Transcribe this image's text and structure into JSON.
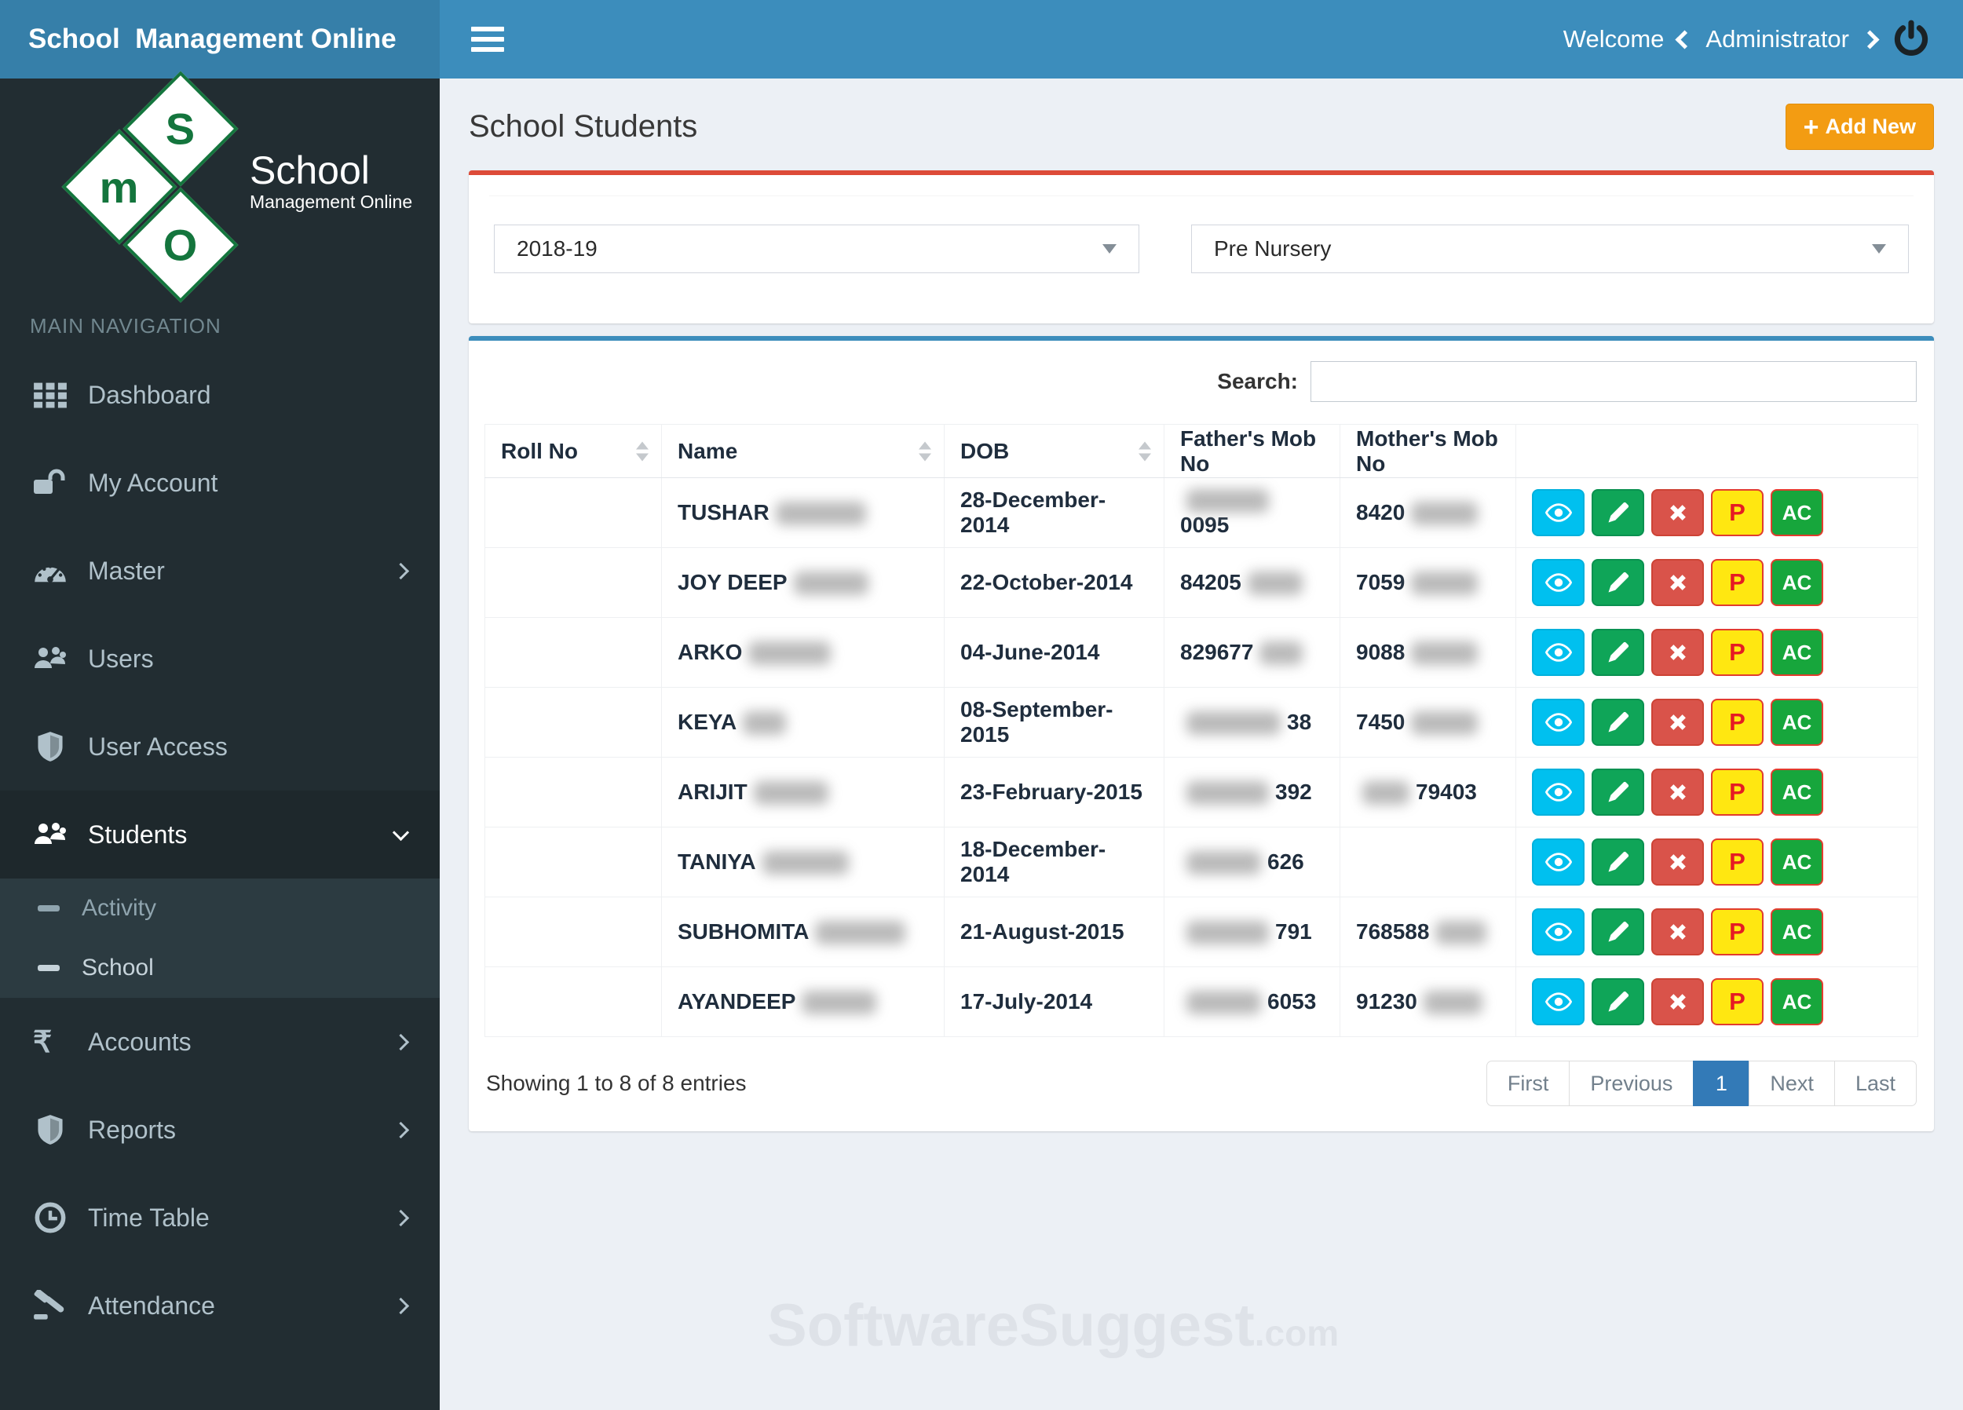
{
  "navbar": {
    "brand": "School  Management Online",
    "welcome": "Welcome",
    "user": "Administrator"
  },
  "logo": {
    "letters": [
      "S",
      "m",
      "O"
    ],
    "title": "School",
    "subtitle": "Management Online"
  },
  "sidebar": {
    "section": "MAIN NAVIGATION",
    "items": [
      {
        "label": "Dashboard",
        "icon": "grid-icon",
        "arrow": "none",
        "active": false
      },
      {
        "label": "My Account",
        "icon": "unlock-icon",
        "arrow": "none",
        "active": false
      },
      {
        "label": "Master",
        "icon": "gauge-icon",
        "arrow": "right",
        "active": false
      },
      {
        "label": "Users",
        "icon": "users-icon",
        "arrow": "none",
        "active": false
      },
      {
        "label": "User Access",
        "icon": "shield-icon",
        "arrow": "none",
        "active": false
      },
      {
        "label": "Students",
        "icon": "users-icon",
        "arrow": "down",
        "active": true,
        "submenu": [
          {
            "label": "Activity",
            "active": false
          },
          {
            "label": "School",
            "active": true
          }
        ]
      },
      {
        "label": "Accounts",
        "icon": "rupee-icon",
        "arrow": "right",
        "active": false
      },
      {
        "label": "Reports",
        "icon": "shield-icon",
        "arrow": "right",
        "active": false
      },
      {
        "label": "Time Table",
        "icon": "clock-icon",
        "arrow": "right",
        "active": false
      },
      {
        "label": "Attendance",
        "icon": "gavel-icon",
        "arrow": "right",
        "active": false
      }
    ]
  },
  "page": {
    "title": "School Students",
    "add_new": "Add New"
  },
  "filters": {
    "session": "2018-19",
    "class": "Pre Nursery"
  },
  "search_label": "Search:",
  "table": {
    "columns": [
      {
        "label": "Roll No",
        "sortable": true
      },
      {
        "label": "Name",
        "sortable": true
      },
      {
        "label": "DOB",
        "sortable": true
      },
      {
        "label": "Father's Mob No",
        "sortable": false
      },
      {
        "label": "Mother's Mob No",
        "sortable": false
      },
      {
        "label": "",
        "sortable": false
      }
    ],
    "rows": [
      {
        "roll": "",
        "name": [
          {
            "text": "TUSHAR"
          },
          {
            "blur": 115
          }
        ],
        "dob": "28-December-2014",
        "father": [
          {
            "blur": 105
          },
          {
            "text": "0095"
          }
        ],
        "mother": [
          {
            "text": "8420"
          },
          {
            "blur": 85
          }
        ]
      },
      {
        "roll": "",
        "name": [
          {
            "text": "JOY DEEP"
          },
          {
            "blur": 95
          }
        ],
        "dob": "22-October-2014",
        "father": [
          {
            "text": "84205"
          },
          {
            "blur": 70
          }
        ],
        "mother": [
          {
            "text": "7059"
          },
          {
            "blur": 85
          }
        ]
      },
      {
        "roll": "",
        "name": [
          {
            "text": "ARKO"
          },
          {
            "blur": 105
          }
        ],
        "dob": "04-June-2014",
        "father": [
          {
            "text": "829677"
          },
          {
            "blur": 55
          }
        ],
        "mother": [
          {
            "text": "9088"
          },
          {
            "blur": 85
          }
        ]
      },
      {
        "roll": "",
        "name": [
          {
            "text": "KEYA"
          },
          {
            "blur": 55
          }
        ],
        "dob": "08-September-2015",
        "father": [
          {
            "blur": 120
          },
          {
            "text": "38"
          }
        ],
        "mother": [
          {
            "text": "7450"
          },
          {
            "blur": 85
          }
        ]
      },
      {
        "roll": "",
        "name": [
          {
            "text": "ARIJIT"
          },
          {
            "blur": 95
          }
        ],
        "dob": "23-February-2015",
        "father": [
          {
            "blur": 105
          },
          {
            "text": "392"
          }
        ],
        "mother": [
          {
            "blur": 60
          },
          {
            "text": "79403"
          }
        ]
      },
      {
        "roll": "",
        "name": [
          {
            "text": "TANIYA"
          },
          {
            "blur": 110
          }
        ],
        "dob": "18-December-2014",
        "father": [
          {
            "blur": 95
          },
          {
            "text": "626"
          }
        ],
        "mother": []
      },
      {
        "roll": "",
        "name": [
          {
            "text": "SUBHOMITA"
          },
          {
            "blur": 115
          }
        ],
        "dob": "21-August-2015",
        "father": [
          {
            "blur": 105
          },
          {
            "text": "791"
          }
        ],
        "mother": [
          {
            "text": "768588"
          },
          {
            "blur": 65
          }
        ]
      },
      {
        "roll": "",
        "name": [
          {
            "text": "AYANDEEP"
          },
          {
            "blur": 95
          }
        ],
        "dob": "17-July-2014",
        "father": [
          {
            "blur": 95
          },
          {
            "text": "6053"
          }
        ],
        "mother": [
          {
            "text": "91230"
          },
          {
            "blur": 75
          }
        ]
      }
    ],
    "actions": [
      {
        "name": "view",
        "icon": "eye-icon",
        "style": "btn-view"
      },
      {
        "name": "edit",
        "icon": "pencil-icon",
        "style": "btn-edit"
      },
      {
        "name": "delete",
        "icon": "cross-icon",
        "style": "btn-delete"
      },
      {
        "name": "promote",
        "label": "P",
        "style": "btn-p"
      },
      {
        "name": "ac",
        "label": "AC",
        "style": "btn-ac"
      }
    ]
  },
  "footer": {
    "showing": "Showing 1 to 8 of 8 entries",
    "pagination": [
      "First",
      "Previous",
      "1",
      "Next",
      "Last"
    ],
    "active_page": "1"
  },
  "watermark": {
    "main": "SoftwareSuggest",
    "suffix": ".com"
  },
  "colors": {
    "navbar": "#3c8dbc",
    "logo_bg": "#367fa9",
    "sidebar": "#222d32",
    "sidebar_active": "#1e282c",
    "submenu_bg": "#2c3b41",
    "accent_red": "#dd4b39",
    "accent_blue": "#3c8dbc",
    "button_orange": "#f39c12",
    "action_view": "#00c0ef",
    "action_edit": "#0fa558",
    "action_delete": "#d9534a",
    "action_p_bg": "#ffe711",
    "action_ac_bg": "#17a63c",
    "pagination_active": "#337ab7",
    "logo_green": "#14753d"
  }
}
